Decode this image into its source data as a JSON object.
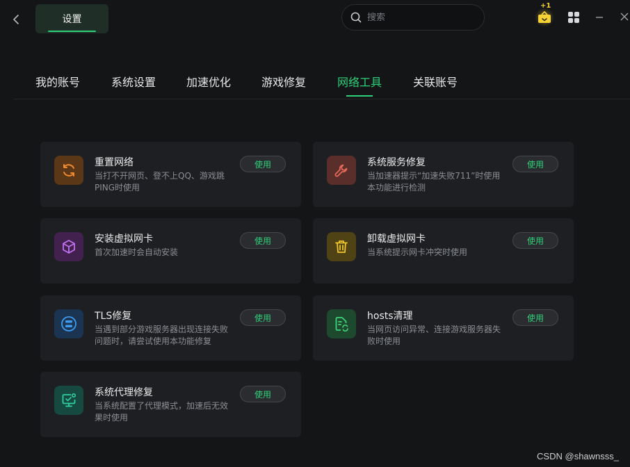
{
  "window": {
    "title_tab": "设置",
    "search_placeholder": "搜索",
    "reward_badge": "+1"
  },
  "tabs": [
    {
      "label": "我的账号",
      "active": false
    },
    {
      "label": "系统设置",
      "active": false
    },
    {
      "label": "加速优化",
      "active": false
    },
    {
      "label": "游戏修复",
      "active": false
    },
    {
      "label": "网络工具",
      "active": true
    },
    {
      "label": "关联账号",
      "active": false
    }
  ],
  "tools": [
    {
      "title": "重置网络",
      "desc": "当打不开网页、登不上QQ、游戏跳PING时使用",
      "button": "使用",
      "icon": "refresh-icon",
      "color": "#f08a2c"
    },
    {
      "title": "系统服务修复",
      "desc": "当加速器提示“加速失败711”时使用本功能进行检测",
      "button": "使用",
      "icon": "wrench-icon",
      "color": "#e56a5a"
    },
    {
      "title": "安装虚拟网卡",
      "desc": "首次加速时会自动安装",
      "button": "使用",
      "icon": "cube-icon",
      "color": "#c070f0"
    },
    {
      "title": "卸载虚拟网卡",
      "desc": "当系统提示网卡冲突时使用",
      "button": "使用",
      "icon": "trash-icon",
      "color": "#f2c72c"
    },
    {
      "title": "TLS修复",
      "desc": "当遇到部分游戏服务器出现连接失败问题时，请尝试使用本功能修复",
      "button": "使用",
      "icon": "tls-icon",
      "color": "#3e9cf0"
    },
    {
      "title": "hosts清理",
      "desc": "当网页访问异常、连接游戏服务器失败时使用",
      "button": "使用",
      "icon": "file-sync-icon",
      "color": "#3ed37a"
    },
    {
      "title": "系统代理修复",
      "desc": "当系统配置了代理模式，加速后无效果时使用",
      "button": "使用",
      "icon": "monitor-icon",
      "color": "#2fd0a0"
    }
  ],
  "watermark": "CSDN @shawnsss_"
}
